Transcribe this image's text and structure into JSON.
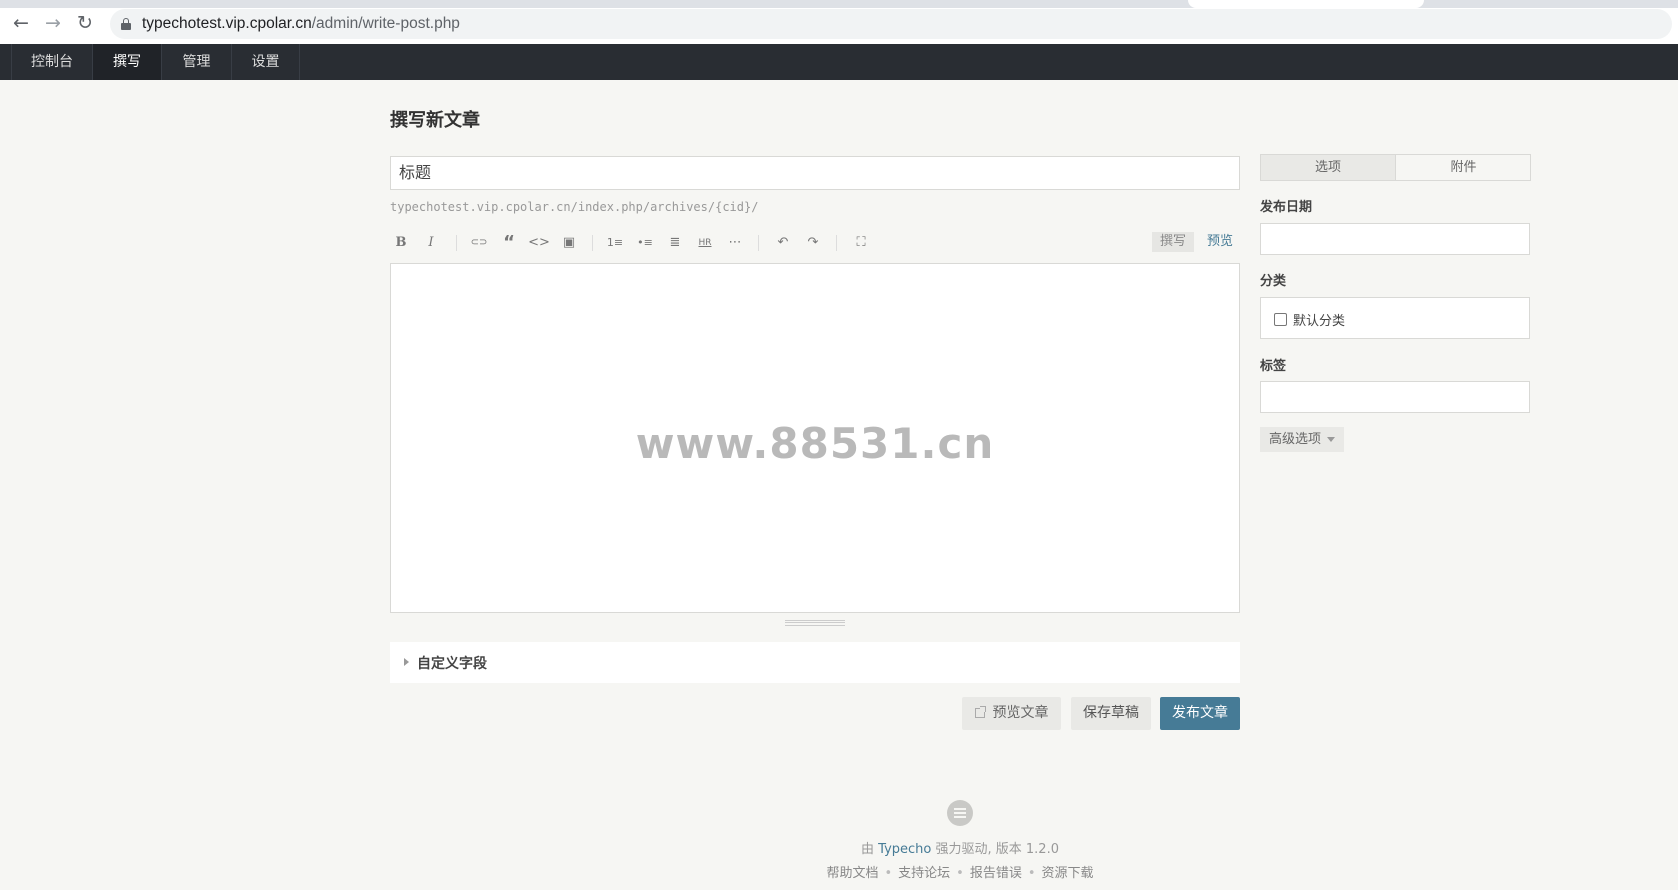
{
  "browser": {
    "url_host": "typechotest.vip.cpolar.cn",
    "url_path": "/admin/write-post.php"
  },
  "nav": {
    "items": [
      {
        "label": "控制台"
      },
      {
        "label": "撰写"
      },
      {
        "label": "管理"
      },
      {
        "label": "设置"
      }
    ],
    "active": "撰写"
  },
  "main": {
    "page_title": "撰写新文章",
    "title_placeholder": "标题",
    "slug_url": "typechotest.vip.cpolar.cn/index.php/archives/{cid}/",
    "editor": {
      "mode_write": "撰写",
      "mode_preview": "预览",
      "watermark": "www.88531.cn",
      "toolbar": {
        "bold": "B",
        "italic": "I",
        "link": "⊂⊃",
        "quote": "“",
        "code": "<>",
        "image": "▣",
        "ordered_list": "1≡",
        "unordered_list": "•≡",
        "heading": "≣",
        "hr": "HR",
        "more": "⋯",
        "undo": "↶",
        "redo": "↷",
        "fullscreen": "⛶"
      }
    },
    "custom_fields_label": "自定义字段",
    "buttons": {
      "preview": "预览文章",
      "save_draft": "保存草稿",
      "publish": "发布文章"
    }
  },
  "sidebar": {
    "tabs": [
      "选项",
      "附件"
    ],
    "publish_date_label": "发布日期",
    "category_label": "分类",
    "default_category": "默认分类",
    "tags_label": "标签",
    "advanced_options": "高级选项"
  },
  "footer": {
    "by": "由",
    "brand": "Typecho",
    "powered": "强力驱动, 版本 1.2.0",
    "links": [
      "帮助文档",
      "支持论坛",
      "报告错误",
      "资源下载"
    ]
  }
}
